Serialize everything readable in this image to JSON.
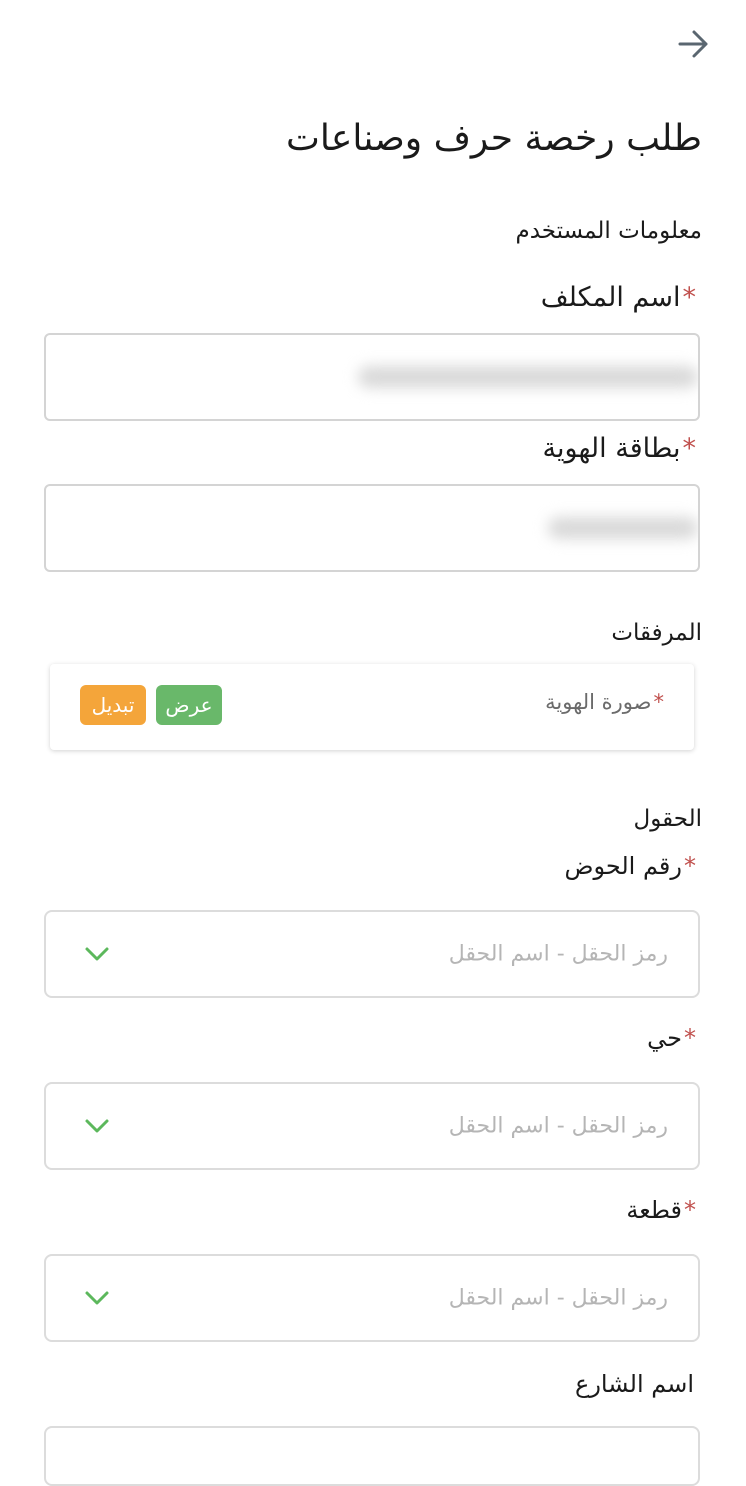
{
  "header": {
    "back_icon": "arrow-right-icon",
    "title": "طلب رخصة حرف وصناعات"
  },
  "user_info": {
    "section_title": "معلومات المستخدم",
    "name_label": "اسم المكلف",
    "id_card_label": "بطاقة الهوية"
  },
  "attachments": {
    "section_title": "المرفقات",
    "items": [
      {
        "label": "صورة الهوية",
        "view_label": "عرض",
        "replace_label": "تبديل"
      }
    ]
  },
  "fields": {
    "section_title": "الحقول",
    "items": [
      {
        "label": "رقم الحوض",
        "placeholder": "رمز الحقل - اسم الحقل",
        "required": true
      },
      {
        "label": "حي",
        "placeholder": "رمز الحقل - اسم الحقل",
        "required": true
      },
      {
        "label": "قطعة",
        "placeholder": "رمز الحقل - اسم الحقل",
        "required": true
      },
      {
        "label": "اسم الشارع",
        "required": false
      }
    ]
  },
  "colors": {
    "required_marker": "#c0504d",
    "view_button": "#69b86a",
    "replace_button": "#f4a53a",
    "chevron": "#5cb85c"
  }
}
